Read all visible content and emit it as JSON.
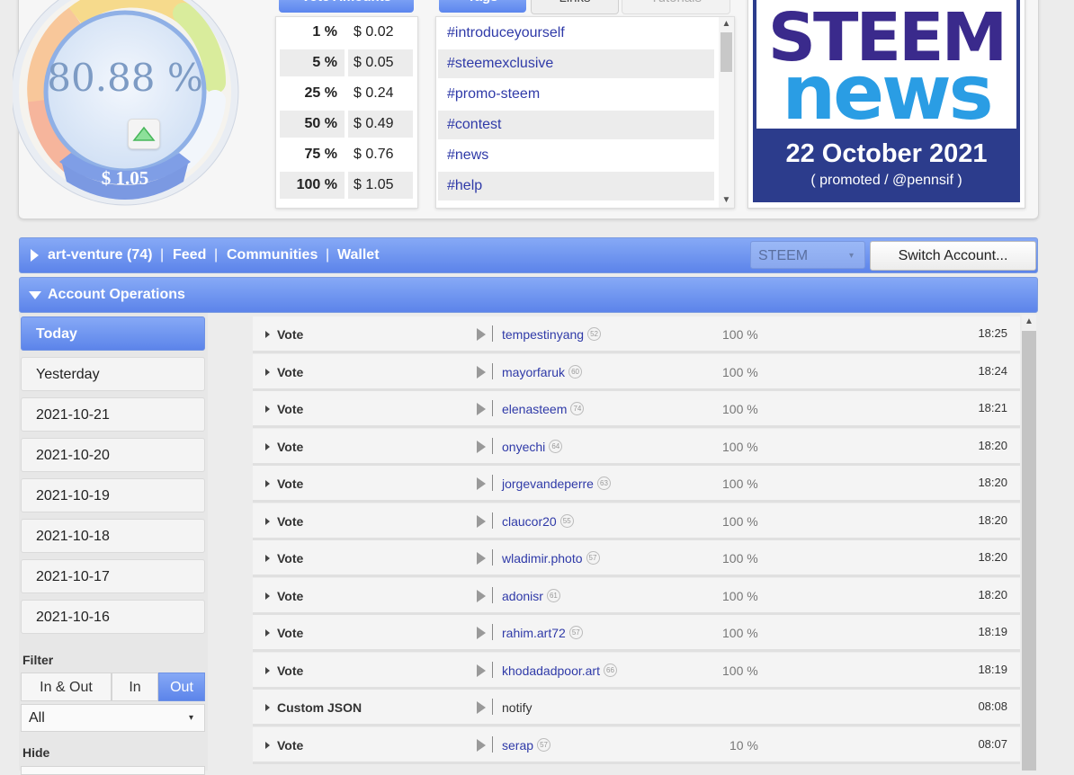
{
  "gauge": {
    "percent_label": "80.88 %",
    "value_label": "$ 1.05",
    "level": 0.8088
  },
  "vote_amounts": {
    "header": "Vote Amounts",
    "rows": [
      {
        "pct": "1 %",
        "usd": "$ 0.02"
      },
      {
        "pct": "5 %",
        "usd": "$ 0.05"
      },
      {
        "pct": "25 %",
        "usd": "$ 0.24"
      },
      {
        "pct": "50 %",
        "usd": "$ 0.49"
      },
      {
        "pct": "75 %",
        "usd": "$ 0.76"
      },
      {
        "pct": "100 %",
        "usd": "$ 1.05"
      }
    ]
  },
  "tag_tabs": {
    "tags": "Tags",
    "links": "Links",
    "tutorials": "Tutorials"
  },
  "tags": [
    "#introduceyourself",
    "#steemexclusive",
    "#promo-steem",
    "#contest",
    "#news",
    "#help"
  ],
  "news": {
    "logo_line1": "STEEM",
    "logo_line2": "news",
    "date": "22 October 2021",
    "subtitle": "( promoted / @pennsif )"
  },
  "account_bar": {
    "account": "art-venture (74)",
    "sep": "|",
    "feed": "Feed",
    "communities": "Communities",
    "wallet": "Wallet",
    "currency": "STEEM",
    "currency_arrow": "▾",
    "switch_label": "Switch Account..."
  },
  "ops_header": {
    "title": "Account Operations"
  },
  "date_nav": {
    "items": [
      "Today",
      "Yesterday",
      "2021-10-21",
      "2021-10-20",
      "2021-10-19",
      "2021-10-18",
      "2021-10-17",
      "2021-10-16"
    ],
    "filter_label": "Filter",
    "filter_options": [
      "In & Out",
      "In",
      "Out"
    ],
    "all_label": "All",
    "all_arrow": "▾",
    "hide_label": "Hide"
  },
  "operations": [
    {
      "type": "Vote",
      "target": "tempestinyang",
      "rep": "52",
      "weight": "100 %",
      "time": "18:25"
    },
    {
      "type": "Vote",
      "target": "mayorfaruk",
      "rep": "60",
      "weight": "100 %",
      "time": "18:24"
    },
    {
      "type": "Vote",
      "target": "elenasteem",
      "rep": "74",
      "weight": "100 %",
      "time": "18:21"
    },
    {
      "type": "Vote",
      "target": "onyechi",
      "rep": "64",
      "weight": "100 %",
      "time": "18:20"
    },
    {
      "type": "Vote",
      "target": "jorgevandeperre",
      "rep": "63",
      "weight": "100 %",
      "time": "18:20"
    },
    {
      "type": "Vote",
      "target": "claucor20",
      "rep": "55",
      "weight": "100 %",
      "time": "18:20"
    },
    {
      "type": "Vote",
      "target": "wladimir.photo",
      "rep": "57",
      "weight": "100 %",
      "time": "18:20"
    },
    {
      "type": "Vote",
      "target": "adonisr",
      "rep": "61",
      "weight": "100 %",
      "time": "18:20"
    },
    {
      "type": "Vote",
      "target": "rahim.art72",
      "rep": "57",
      "weight": "100 %",
      "time": "18:19"
    },
    {
      "type": "Vote",
      "target": "khodadadpoor.art",
      "rep": "66",
      "weight": "100 %",
      "time": "18:19"
    },
    {
      "type": "Custom JSON",
      "target": "notify",
      "rep": "",
      "weight": "",
      "time": "08:08"
    },
    {
      "type": "Vote",
      "target": "serap",
      "rep": "57",
      "weight": "10 %",
      "time": "08:07"
    }
  ],
  "colors": {
    "accent": "#5c84ea",
    "link": "#2f3aa8",
    "news_bg": "#2c3c8c",
    "news_blue": "#2a9de4",
    "news_purple": "#3a2a8c"
  }
}
